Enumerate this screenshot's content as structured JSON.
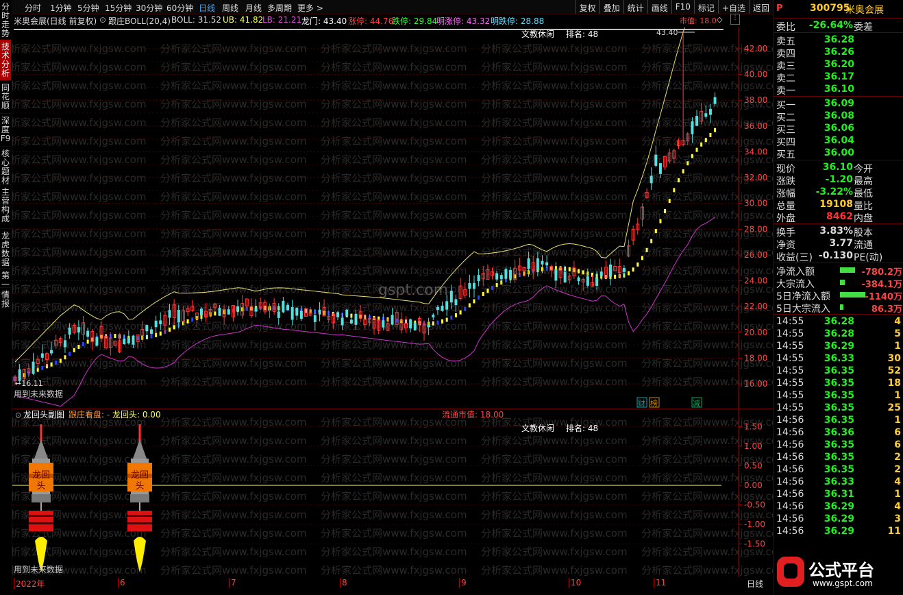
{
  "left_tabs": [
    {
      "label": "分时走势",
      "active": false
    },
    {
      "label": "技术分析",
      "active": true
    },
    {
      "label": "同花顺",
      "active": false
    },
    {
      "label": "深度F9",
      "active": false
    },
    {
      "label": "核心题材",
      "active": false
    },
    {
      "label": "主营构成",
      "active": false
    },
    {
      "label": "龙虎数据",
      "active": false
    },
    {
      "label": "第一",
      "active": false
    },
    {
      "label": "情报",
      "active": false
    }
  ],
  "toolbar": {
    "periods": [
      "分时",
      "1分钟",
      "5分钟",
      "15分钟",
      "30分钟",
      "60分钟",
      "日线",
      "周线",
      "月线",
      "多周期",
      "更多 >"
    ],
    "active_period": "日线",
    "right_tools": [
      "复权",
      "叠加",
      "统计",
      "画线",
      "F10",
      "标记",
      "+自选",
      "返回"
    ]
  },
  "info": {
    "title": "米奥会展(日线 前复权)",
    "indicator": "跟庄BOLL(20,4)",
    "boll": "BOLL: 31.52",
    "ub": "UB: 41.82",
    "lb": "LB: 21.21",
    "longmen": "龙门: 43.40",
    "zhangting": "涨停: 44.76",
    "dieting": "跌停: 29.84",
    "ming_zhangting": "明涨停: 43.32",
    "ming_dieting": "明跌停: 28.88",
    "market_value_short": "市值: 18.0"
  },
  "main_chart": {
    "rank_label": "文教休闲",
    "rank": "排名: 48",
    "high_marker": "43.40",
    "low_marker": "16.11",
    "future_data": "用到未来数据",
    "event_badges": [
      "财",
      "榜",
      "减"
    ],
    "y_ticks": [
      "42.00",
      "40.00",
      "38.00",
      "36.00",
      "34.00",
      "32.00",
      "30.00",
      "28.00",
      "26.00",
      "24.00",
      "22.00",
      "20.00",
      "18.00",
      "16.00"
    ],
    "watermark": "分析家公式网www.fxjgsw.com",
    "center_watermark": "gspt.com"
  },
  "sub_chart": {
    "title": "龙回头副图",
    "follow_label": "跟庄看盘:",
    "dragon_value": "龙回头: 0.00",
    "circulating_label": "流通市值: 18.00",
    "rank_label": "文教休闲",
    "rank": "排名: 48",
    "rocket_text": "龙回头",
    "future_data": "用到未来数据",
    "y_ticks": [
      "1.50",
      "1.00",
      "0.50",
      "0.00",
      "-0.50",
      "-1.00",
      "-1.50"
    ]
  },
  "x_axis": {
    "labels": [
      "2022年",
      "6",
      "7",
      "8",
      "9",
      "10",
      "11"
    ],
    "right_label": "日线"
  },
  "quote": {
    "badge": "P",
    "code": "300795",
    "name": "米奥会展",
    "weibi_label": "委比",
    "weibi": "-26.64%",
    "weicha_label": "委差",
    "asks": [
      {
        "label": "卖五",
        "price": "36.28"
      },
      {
        "label": "卖四",
        "price": "36.26"
      },
      {
        "label": "卖三",
        "price": "36.20"
      },
      {
        "label": "卖二",
        "price": "36.17"
      },
      {
        "label": "卖一",
        "price": "36.10"
      }
    ],
    "bids": [
      {
        "label": "买一",
        "price": "36.09"
      },
      {
        "label": "买二",
        "price": "36.08"
      },
      {
        "label": "买三",
        "price": "36.06"
      },
      {
        "label": "买四",
        "price": "36.04"
      },
      {
        "label": "买五",
        "price": "36.00"
      }
    ],
    "stats1": [
      {
        "label": "现价",
        "value": "36.10",
        "right": "今开",
        "color": "#2e2"
      },
      {
        "label": "涨跌",
        "value": "-1.20",
        "right": "最高",
        "color": "#2e2"
      },
      {
        "label": "涨幅",
        "value": "-3.22%",
        "right": "最低",
        "color": "#2e2"
      },
      {
        "label": "总量",
        "value": "19108",
        "right": "量比",
        "color": "#fc3"
      },
      {
        "label": "外盘",
        "value": "8462",
        "right": "内盘",
        "color": "#f33"
      }
    ],
    "stats2": [
      {
        "label": "换手",
        "value": "3.83%",
        "right": "股本",
        "color": "#ddd"
      },
      {
        "label": "净资",
        "value": "3.77",
        "right": "流通",
        "color": "#ddd"
      },
      {
        "label": "收益(三)",
        "value": "-0.130",
        "right": "PE(动)",
        "color": "#ddd"
      }
    ],
    "flows": [
      {
        "label": "净流入额",
        "value": "-780.2万",
        "bar": 0.3
      },
      {
        "label": "大宗流入",
        "value": "-384.1万",
        "bar": 0.05
      },
      {
        "label": "5日净流入额",
        "value": "-1140万",
        "bar": 0.55
      },
      {
        "label": "5日大宗流入",
        "value": "86.3万",
        "bar": 0.02
      }
    ],
    "ticks": [
      {
        "time": "14:55",
        "price": "36.28",
        "vol": "4"
      },
      {
        "time": "14:55",
        "price": "36.28",
        "vol": "5"
      },
      {
        "time": "14:55",
        "price": "36.29",
        "vol": "1"
      },
      {
        "time": "14:55",
        "price": "36.33",
        "vol": "30"
      },
      {
        "time": "14:55",
        "price": "36.35",
        "vol": "52"
      },
      {
        "time": "14:55",
        "price": "36.35",
        "vol": "18"
      },
      {
        "time": "14:55",
        "price": "36.35",
        "vol": "1"
      },
      {
        "time": "14:55",
        "price": "36.35",
        "vol": "25"
      },
      {
        "time": "14:56",
        "price": "36.35",
        "vol": "1"
      },
      {
        "time": "14:56",
        "price": "36.36",
        "vol": "6"
      },
      {
        "time": "14:56",
        "price": "36.35",
        "vol": "6"
      },
      {
        "time": "14:56",
        "price": "36.35",
        "vol": "2"
      },
      {
        "time": "14:56",
        "price": "36.35",
        "vol": "2"
      },
      {
        "time": "14:56",
        "price": "36.33",
        "vol": "4"
      },
      {
        "time": "14:56",
        "price": "36.31",
        "vol": "1"
      },
      {
        "time": "14:56",
        "price": "36.29",
        "vol": "4"
      },
      {
        "time": "14:56",
        "price": "36.29",
        "vol": "3"
      },
      {
        "time": "14:56",
        "price": "36.29",
        "vol": "11"
      }
    ],
    "brand_text": "公式平台",
    "brand_url": "www.gspt.com"
  },
  "colors": {
    "up": "#ff3b3b",
    "down": "#55e0e0",
    "yellow": "#ffff33",
    "ub": "#e8e070",
    "lb": "#cc33cc",
    "boll_down": "#2244ff",
    "grid": "#5a0000"
  }
}
